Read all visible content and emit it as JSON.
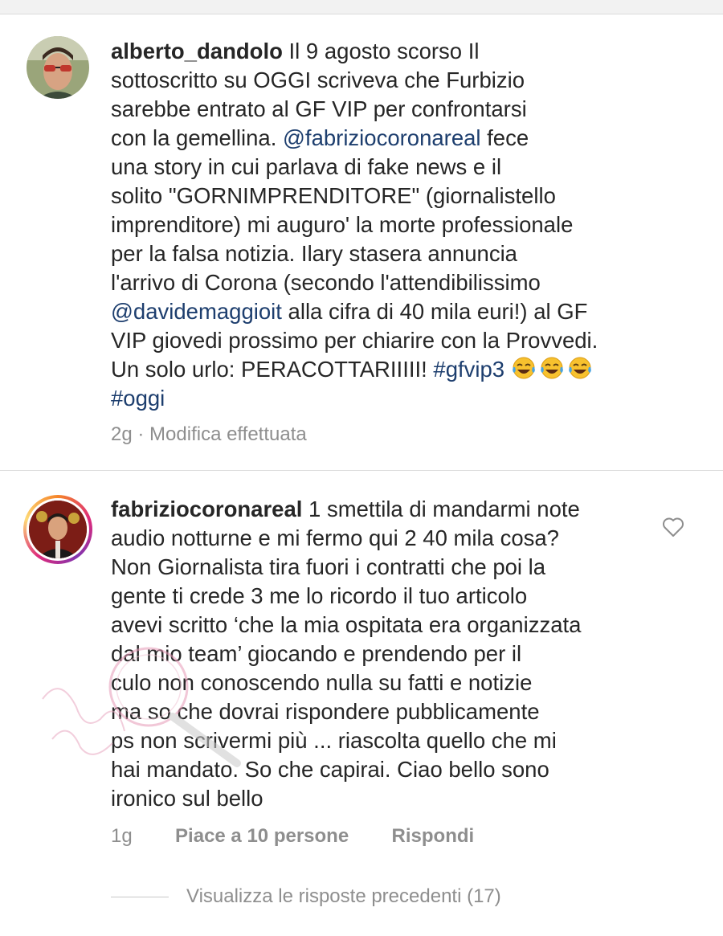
{
  "comments": [
    {
      "username": "alberto_dandolo",
      "lines": [
        [
          {
            "t": "Il 9 agosto scorso Il"
          }
        ],
        [
          {
            "t": "sottoscritto su OGGI  scriveva che Furbizio"
          }
        ],
        [
          {
            "t": "sarebbe entrato al GF VIP per confrontarsi"
          }
        ],
        [
          {
            "t": "con la gemellina. "
          },
          {
            "t": "@fabriziocoronareal",
            "m": true
          },
          {
            "t": "  fece"
          }
        ],
        [
          {
            "t": "una story in cui parlava di fake news e il"
          }
        ],
        [
          {
            "t": "solito \"GORNIMPRENDITORE\" (giornalistello"
          }
        ],
        [
          {
            "t": "imprenditore) mi auguro' la morte professionale"
          }
        ],
        [
          {
            "t": "per la falsa notizia. Ilary stasera annuncia"
          }
        ],
        [
          {
            "t": "l'arrivo di Corona (secondo l'attendibilissimo"
          }
        ],
        [
          {
            "t": "@davidemaggioit",
            "m": true
          },
          {
            "t": "  alla cifra di 40 mila euri!) al GF"
          }
        ],
        [
          {
            "t": "VIP giovedi prossimo per chiarire con la Provvedi."
          }
        ],
        [
          {
            "t": "Un solo urlo: PERACOTTARIIIII! "
          },
          {
            "t": "#gfvip3",
            "m": true
          },
          {
            "t": " "
          },
          {
            "emoji": "joy"
          },
          {
            "emoji": "joy"
          },
          {
            "emoji": "joy"
          }
        ],
        [
          {
            "t": "#oggi",
            "m": true
          }
        ]
      ],
      "age": "2g",
      "separator": "·",
      "edited": "Modifica effettuata"
    },
    {
      "username": "fabriziocoronareal",
      "lines": [
        [
          {
            "t": "1 smettila di mandarmi note"
          }
        ],
        [
          {
            "t": "audio notturne e mi fermo qui 2 40 mila cosa?"
          }
        ],
        [
          {
            "t": "Non Giornalista tira fuori i contratti che poi la"
          }
        ],
        [
          {
            "t": "gente ti crede 3 me lo ricordo il tuo articolo"
          }
        ],
        [
          {
            "t": "avevi scritto ‘che la mia ospitata era organizzata"
          }
        ],
        [
          {
            "t": "dal mio team’ giocando e prendendo per il"
          }
        ],
        [
          {
            "t": "culo non conoscendo nulla su fatti e notizie"
          }
        ],
        [
          {
            "t": "ma so che dovrai rispondere pubblicamente"
          }
        ],
        [
          {
            "t": "ps non scrivermi più ... riascolta quello che mi"
          }
        ],
        [
          {
            "t": "hai mandato. So che capirai. Ciao bello sono"
          }
        ],
        [
          {
            "t": "ironico sul bello"
          }
        ]
      ],
      "age": "1g",
      "likes": "Piace a 10 persone",
      "reply": "Rispondi"
    }
  ],
  "view_previous": "Visualizza le risposte precedenti (17)",
  "colors": {
    "mention": "#1d3e6e",
    "meta": "#8e8e8e",
    "text": "#262626",
    "divider": "#dbdbdb"
  }
}
